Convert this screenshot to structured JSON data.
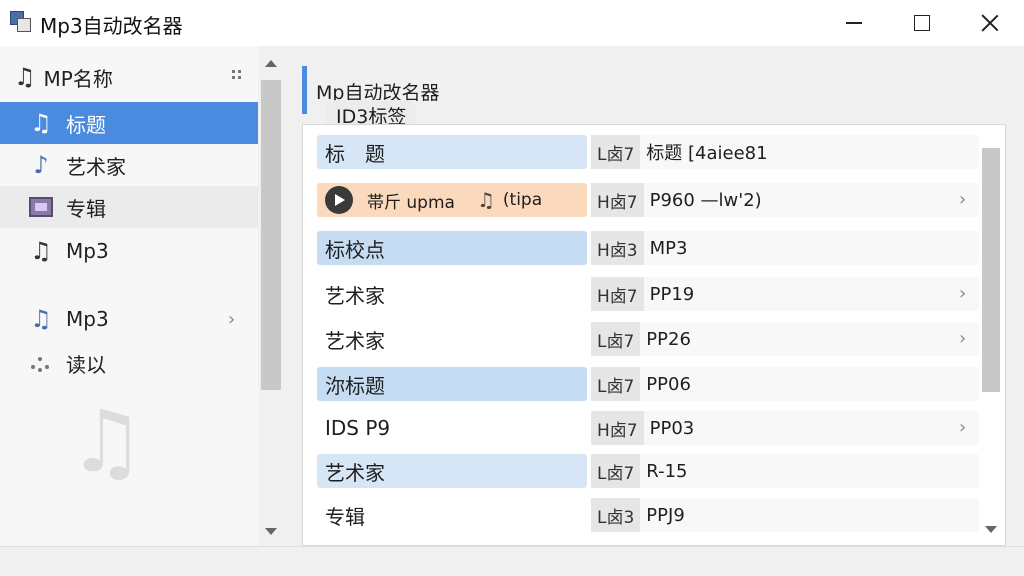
{
  "window": {
    "title": "Mp3自动改名器"
  },
  "sidebar": {
    "header": "MP名称",
    "items": [
      {
        "label": "标题",
        "icon": "music-note-icon",
        "active": true
      },
      {
        "label": "艺术家",
        "icon": "single-note-icon"
      },
      {
        "label": "专辑",
        "icon": "album-icon"
      },
      {
        "label": "Mp3",
        "icon": "music-note-icon"
      },
      {
        "label": "Mp3",
        "icon": "music-note-icon",
        "chevron": "›"
      },
      {
        "label": "读以",
        "icon": "dots-icon"
      }
    ],
    "watermark": "♫"
  },
  "main": {
    "group_title": "Mp自动改名器",
    "section_label": "ID3标签",
    "rows": [
      {
        "left": "标　题",
        "tag": "L卤7",
        "value": "标题 [4aiee81",
        "chevron": "",
        "style": "blue"
      },
      {
        "left": "帯斤 upma",
        "left_extra": "(tipa",
        "tag": "H卤7",
        "value": "P960 —lw'2)",
        "chevron": "›",
        "style": "orange"
      },
      {
        "left": "标校点",
        "tag": "H卤3",
        "value": "MP3",
        "chevron": "",
        "style": "blue2"
      },
      {
        "left": "艺术家",
        "tag": "H卤7",
        "value": "PP19",
        "chevron": "›",
        "style": ""
      },
      {
        "left": "艺术家",
        "tag": "L卤7",
        "value": "PP26",
        "chevron": "›",
        "style": ""
      },
      {
        "left": "沵标题",
        "tag": "L卤7",
        "value": "PP06",
        "chevron": "",
        "style": "blue2"
      },
      {
        "left": "IDS P9",
        "tag": "H卤7",
        "value": "PP03",
        "chevron": "›",
        "style": ""
      },
      {
        "left": "艺术家",
        "tag": "L卤7",
        "value": "R-15",
        "chevron": "",
        "style": "blue"
      },
      {
        "left": "专辑",
        "tag": "L卤3",
        "value": "PPJ9",
        "chevron": "",
        "style": ""
      }
    ]
  },
  "colors": {
    "accent": "#4a8be0",
    "row_blue": "#d6e6f7",
    "row_orange": "#fbd9bd"
  }
}
